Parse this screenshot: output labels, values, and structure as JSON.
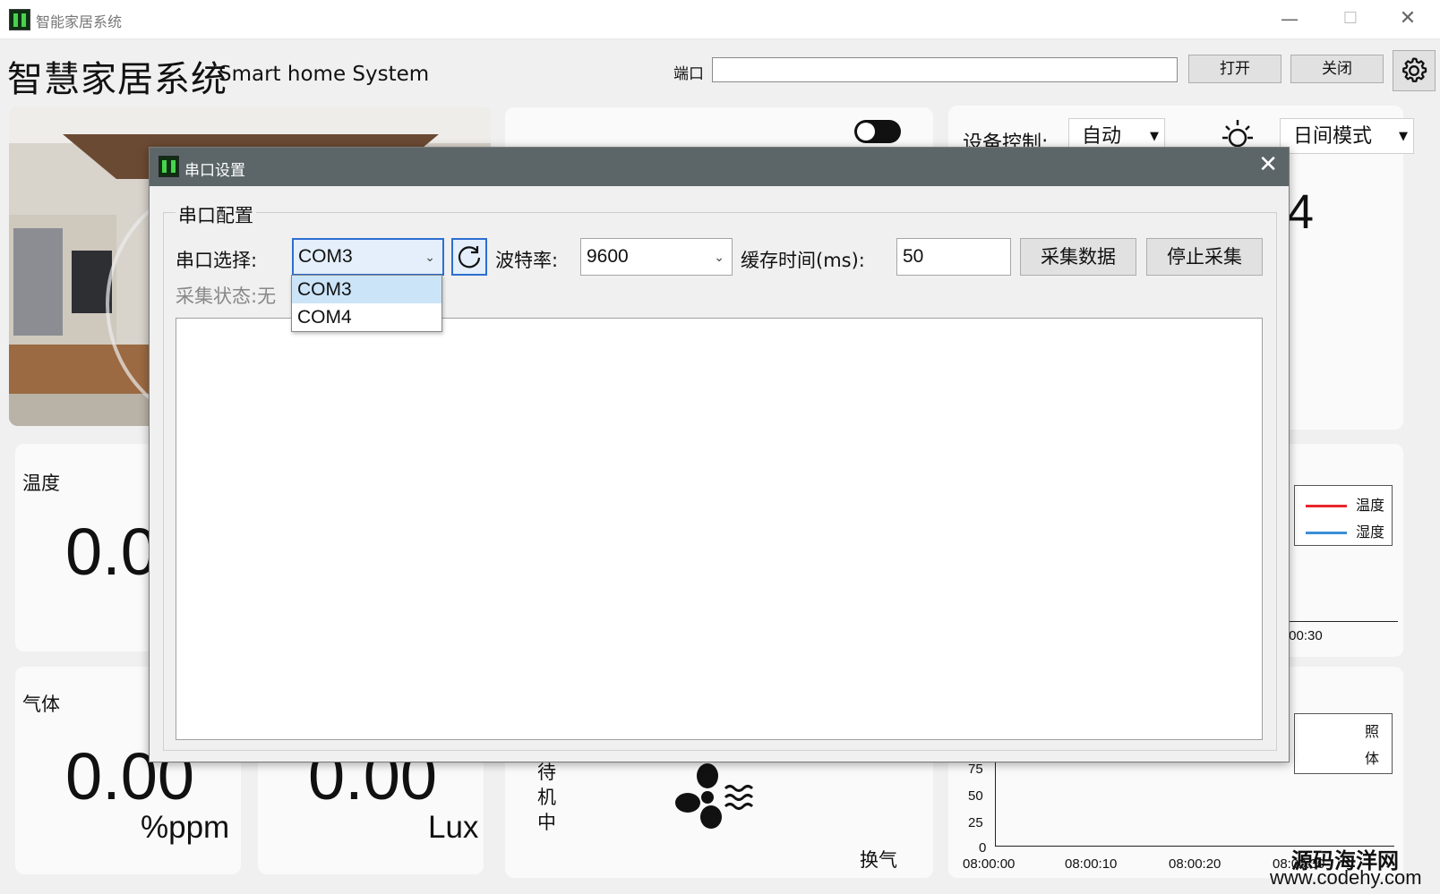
{
  "window": {
    "title": "智能家居系统",
    "min_glyph": "—",
    "max_glyph": "☐",
    "close_glyph": "✕"
  },
  "header": {
    "title_cn": "智慧家居系统",
    "title_en": "Smart home System",
    "port_label": "端口",
    "port_value": "",
    "open_label": "打开",
    "close_label": "关闭"
  },
  "controls": {
    "device_label": "设备控制:",
    "device_mode": "自动",
    "day_mode": "日间模式",
    "count_value": "4"
  },
  "cards": {
    "temp_label": "温度",
    "temp_value": "0.0",
    "gas_label": "气体",
    "gas_value": "0.00",
    "gas_unit": "%ppm",
    "light_value": "0.00",
    "light_unit": "Lux",
    "fan_status": "待机中",
    "fan_label": "换气"
  },
  "chart_top": {
    "legend": [
      "温度",
      "湿度"
    ],
    "colors": [
      "#e8262b",
      "#3b8fd6"
    ],
    "x_tick_partial": ":00:30"
  },
  "chart_bottom": {
    "legend_partial": [
      "照",
      "体"
    ],
    "y_ticks": [
      "75",
      "50",
      "25",
      "0"
    ],
    "x_ticks": [
      "08:00:00",
      "08:00:10",
      "08:00:20",
      "08:00:30"
    ]
  },
  "dialog": {
    "title": "串口设置",
    "close_glyph": "✕",
    "group_title": "串口配置",
    "port_select_label": "串口选择:",
    "port_selected": "COM3",
    "port_options": [
      "COM3",
      "COM4"
    ],
    "baud_label": "波特率:",
    "baud_value": "9600",
    "cache_label": "缓存时间(ms):",
    "cache_value": "50",
    "collect_label": "采集数据",
    "stop_label": "停止采集",
    "status_label": "采集状态:",
    "status_value": "无"
  },
  "watermark": {
    "line1": "源码海洋网",
    "line2": "www.codehy.com"
  }
}
